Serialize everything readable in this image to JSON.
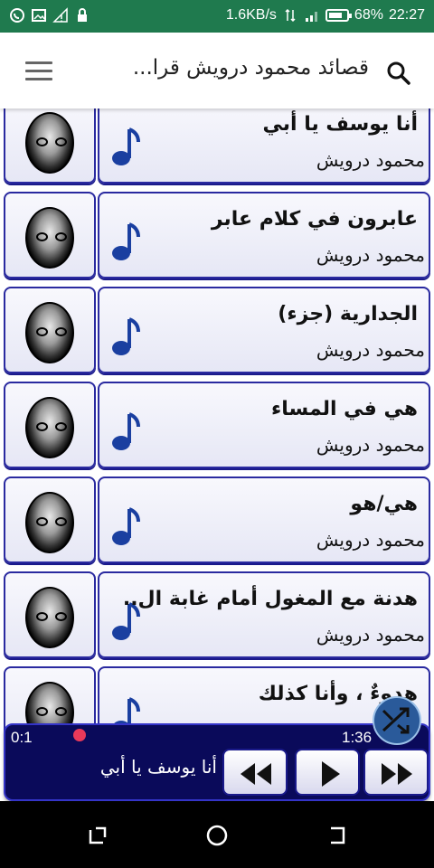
{
  "status": {
    "speed": "1.6KB/s",
    "battery": "68%",
    "time": "22:27",
    "left_icons": [
      "whatsapp-icon",
      "gallery-icon",
      "no-signal-icon",
      "lock-icon"
    ],
    "battery_level": 0.68
  },
  "appbar": {
    "title": "قصائد محمود درويش قرا...",
    "search_icon": "search-icon",
    "menu_icon": "menu-icon"
  },
  "songs": [
    {
      "title": "أنا يوسف يا أبي",
      "artist": "محمود درويش"
    },
    {
      "title": "عابرون في كلام عابر",
      "artist": "محمود درويش"
    },
    {
      "title": "الجدارية (جزء)",
      "artist": "محمود درويش"
    },
    {
      "title": "هي في المساء",
      "artist": "محمود درويش"
    },
    {
      "title": "هي/هو",
      "artist": "محمود درويش"
    },
    {
      "title": "هدنة مع المغول أمام غابة ال..",
      "artist": "محمود درويش"
    },
    {
      "title": "هدوءٌ ، وأنا كذلك",
      "artist": ""
    }
  ],
  "player": {
    "elapsed": "0:1",
    "duration": "1:36",
    "now_playing": "أنا يوسف يا أبي",
    "progress": 0.02,
    "buttons": [
      "rewind-icon",
      "play-icon",
      "fast-forward-icon"
    ],
    "shuffle_icon": "shuffle-icon"
  },
  "colors": {
    "status_bar": "#1f7a4e",
    "card_border": "#2a2aa0",
    "note": "#1a3fa0",
    "player_bg": "#0a0a5a",
    "progress_dot": "#e8395a"
  }
}
